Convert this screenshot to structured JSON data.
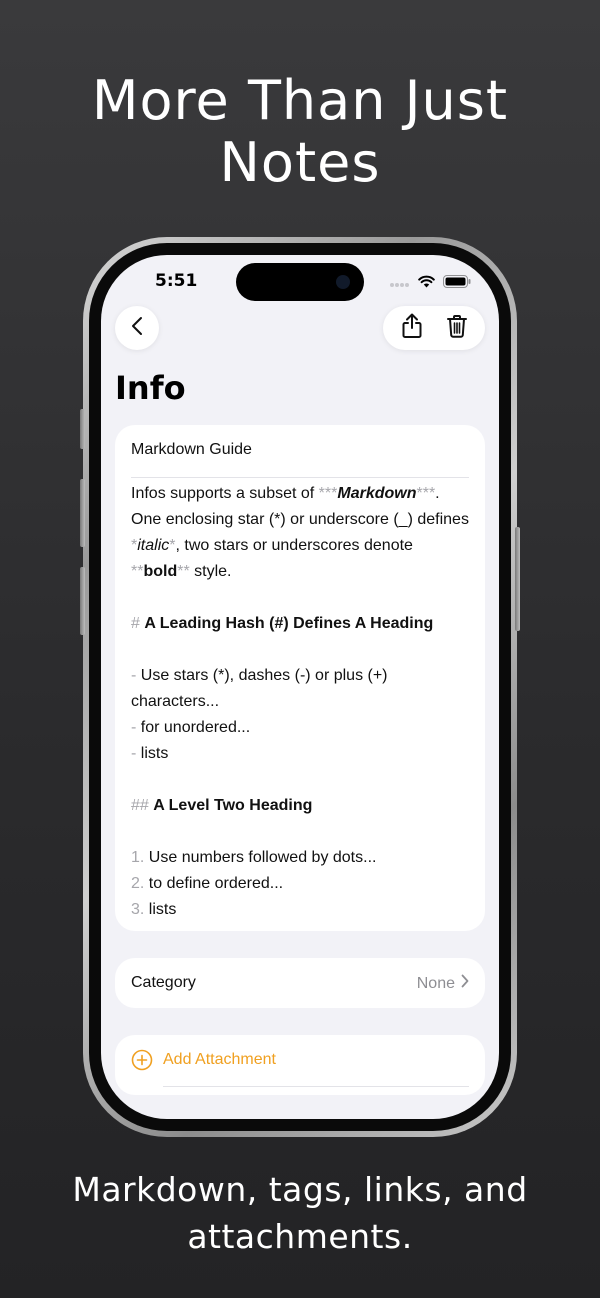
{
  "headline": [
    "More Than Just",
    "Notes"
  ],
  "tagline": [
    "Markdown, tags, links, and",
    "attachments."
  ],
  "status_bar": {
    "time": "5:51"
  },
  "page_title": "Info",
  "note": {
    "title": "Markdown Guide",
    "p1": {
      "a": "Infos supports a subset of ",
      "m1": "***",
      "bi": "Markdown",
      "m2": "***",
      "b": ". One enclosing star (*) or underscore (_) defines ",
      "m3": "*",
      "it": "italic",
      "m4": "*",
      "c": ", two stars or underscores denote ",
      "m5": "**",
      "bo": "bold",
      "m6": "**",
      "d": " style."
    },
    "h1_marker": "#",
    "h1_text": "A Leading Hash (#) Defines A Heading",
    "list_unordered": [
      {
        "marker": "-",
        "text": "Use stars (*), dashes (-) or plus (+) characters..."
      },
      {
        "marker": "-",
        "text": "for unordered..."
      },
      {
        "marker": "-",
        "text": "lists"
      }
    ],
    "h2_marker": "##",
    "h2_text": "A Level Two Heading",
    "list_ordered": [
      {
        "marker": "1.",
        "text": "Use numbers followed by dots..."
      },
      {
        "marker": "2.",
        "text": "to define ordered..."
      },
      {
        "marker": "3.",
        "text": "lists"
      }
    ]
  },
  "category": {
    "label": "Category",
    "value": "None"
  },
  "attachment": {
    "label": "Add Attachment"
  },
  "colors": {
    "accent": "#f0a020",
    "screen_bg": "#f2f2f7",
    "marker_gray": "#a6a6ab"
  },
  "icons": {
    "back": "chevron-left-icon",
    "share": "share-icon",
    "delete": "trash-icon",
    "disclosure": "chevron-right-icon",
    "add": "plus-circle-icon"
  }
}
